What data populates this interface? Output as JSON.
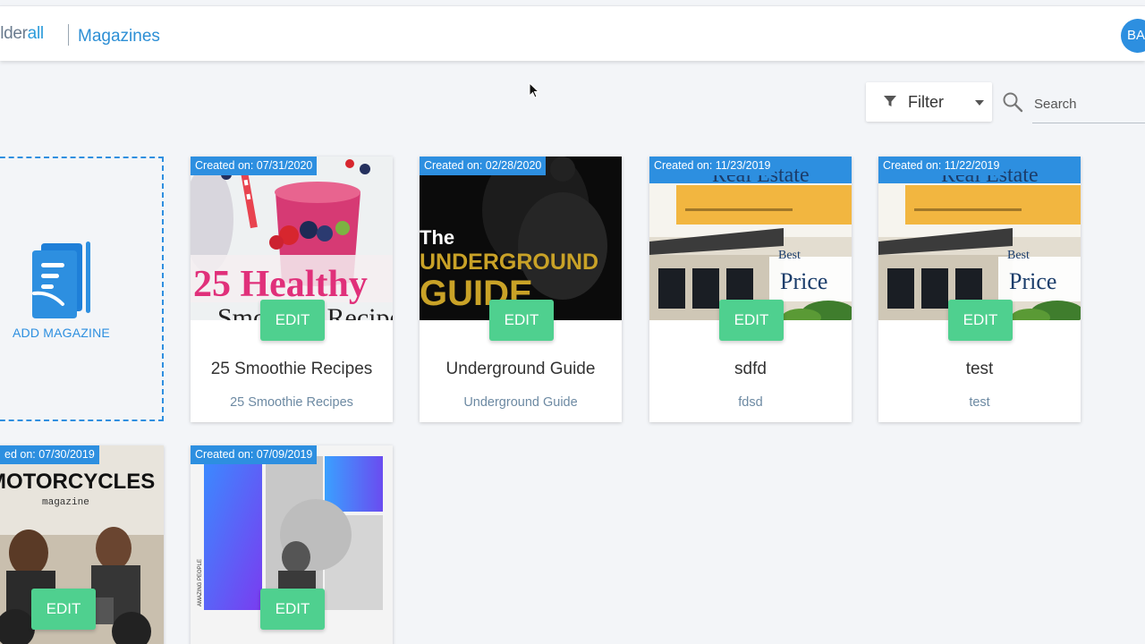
{
  "header": {
    "brand_main": "uilder",
    "brand_accent": "all",
    "section": "Magazines",
    "avatar": "BA"
  },
  "toolbar": {
    "filter_label": "Filter",
    "search_placeholder": "Search"
  },
  "add_card": {
    "label": "ADD MAGAZINE"
  },
  "edit_label": "EDIT",
  "magazines": [
    {
      "date": "Created on: 07/31/2020",
      "title": "25 Smoothie Recipes",
      "subtitle": "25 Smoothie Recipes",
      "cover_line1": "25 Healthy",
      "cover_line2": "Smoothie Recipes"
    },
    {
      "date": "Created on: 02/28/2020",
      "title": "Underground Guide",
      "subtitle": "Underground Guide",
      "cover_line1": "The",
      "cover_line2": "UNDERGROUND",
      "cover_line3": "GUIDE"
    },
    {
      "date": "Created on: 11/23/2019",
      "title": "sdfd",
      "subtitle": "fdsd",
      "cover_line1": "Real Estate",
      "cover_line2": "Best",
      "cover_line3": "Price"
    },
    {
      "date": "Created on: 11/22/2019",
      "title": "test",
      "subtitle": "test",
      "cover_line1": "Real Estate",
      "cover_line2": "Best",
      "cover_line3": "Price"
    },
    {
      "date": "ed on: 07/30/2019",
      "cover_line1": "MOTORCYCLES",
      "cover_line2": "magazine"
    },
    {
      "date": "Created on: 07/09/2019",
      "cover_line1": "AMAZING PEOPLE"
    }
  ],
  "colors": {
    "accent": "#2d8fe0",
    "edit": "#4fd08f"
  }
}
